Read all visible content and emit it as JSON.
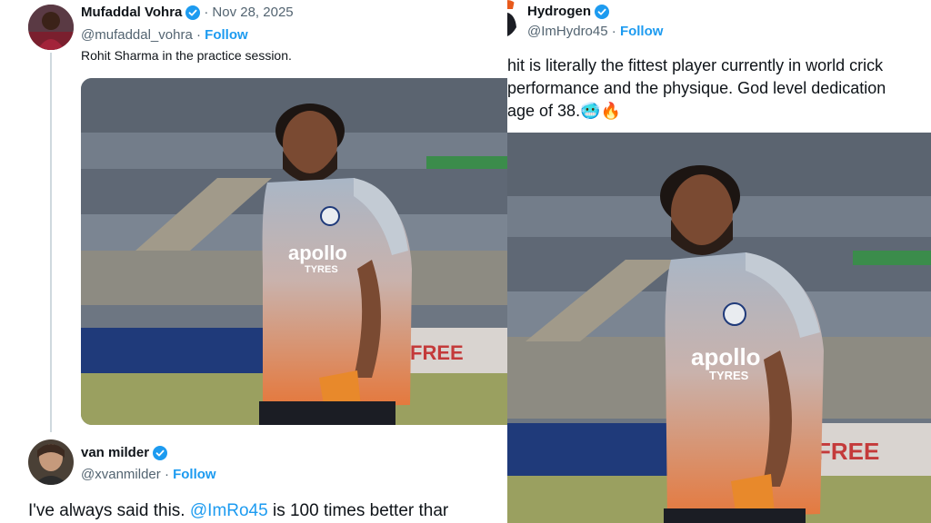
{
  "left": {
    "tweet1": {
      "display_name": "Mufaddal Vohra",
      "handle": "@mufaddal_vohra",
      "date": "Nov 28, 2025",
      "follow_label": "Follow",
      "text": "Rohit Sharma in the practice session."
    },
    "tweet2": {
      "display_name": "van milder",
      "handle": "@xvanmilder",
      "follow_label": "Follow",
      "text_before": "I've always said this. ",
      "mention": "@ImRo45",
      "text_after": "  is 100 times better thar"
    }
  },
  "right": {
    "tweet": {
      "display_name": "Hydrogen",
      "handle": "@ImHydro45",
      "follow_label": "Follow",
      "line1": "hit is literally the fittest player currently in world crick",
      "line2": "performance and the physique. God level dedication",
      "line3": " age of 38.",
      "emojis": "🥶🔥"
    }
  },
  "photo": {
    "jersey_sponsor": "apollo",
    "jersey_sponsor_sub": "TYRES",
    "board_text": "FREE",
    "colors": {
      "stand": "#5b6470",
      "jersey_top": "#a9b6c6",
      "jersey_bottom": "#e5783c",
      "glove": "#e8892b",
      "skin": "#7a4a32",
      "hair": "#1c1512"
    }
  },
  "colors": {
    "accent": "#1d9bf0",
    "secondary_text": "#536471",
    "thread_line": "#cfd9de"
  }
}
